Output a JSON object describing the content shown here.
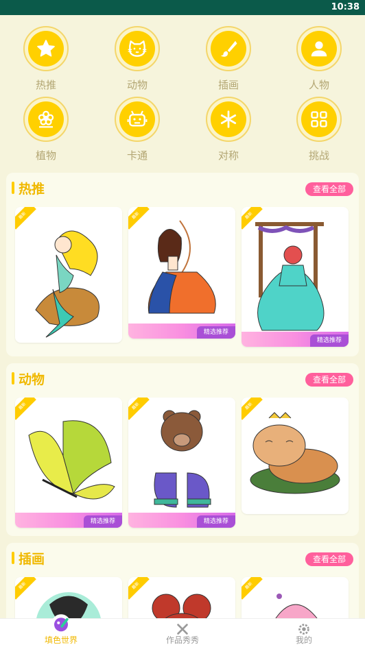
{
  "status": {
    "time": "10:38"
  },
  "categories": [
    {
      "label": "热推",
      "icon": "star-icon"
    },
    {
      "label": "动物",
      "icon": "cat-icon"
    },
    {
      "label": "插画",
      "icon": "brush-icon"
    },
    {
      "label": "人物",
      "icon": "person-icon"
    },
    {
      "label": "植物",
      "icon": "flower-icon"
    },
    {
      "label": "卡通",
      "icon": "robot-icon"
    },
    {
      "label": "对称",
      "icon": "asterisk-icon"
    },
    {
      "label": "挑战",
      "icon": "grid-icon"
    }
  ],
  "sections": [
    {
      "title": "热推",
      "view_all": "查看全部",
      "cards": [
        {
          "image": "mermaid",
          "ribbon": ""
        },
        {
          "image": "archer princess",
          "ribbon": "精选推荐"
        },
        {
          "image": "girl on swing",
          "ribbon": "精选推荐"
        }
      ]
    },
    {
      "title": "动物",
      "view_all": "查看全部",
      "cards": [
        {
          "image": "butterfly",
          "ribbon": "精选推荐"
        },
        {
          "image": "bear with sneakers",
          "ribbon": "精选推荐"
        },
        {
          "image": "sleeping cat",
          "ribbon": ""
        }
      ]
    },
    {
      "title": "插画",
      "view_all": "查看全部",
      "cards": [
        {
          "image": "illustration 1",
          "ribbon": ""
        },
        {
          "image": "illustration 2",
          "ribbon": ""
        },
        {
          "image": "illustration 3",
          "ribbon": ""
        }
      ]
    }
  ],
  "new_badge": "最新",
  "tabs": [
    {
      "label": "填色世界",
      "icon": "palette-icon",
      "active": true
    },
    {
      "label": "作品秀秀",
      "icon": "brush-cross-icon",
      "active": false
    },
    {
      "label": "我的",
      "icon": "settings-icon",
      "active": false
    }
  ],
  "colors": {
    "accent": "#ffcc00",
    "pink": "#ff5f9c",
    "status_bar": "#0b5a4a"
  }
}
